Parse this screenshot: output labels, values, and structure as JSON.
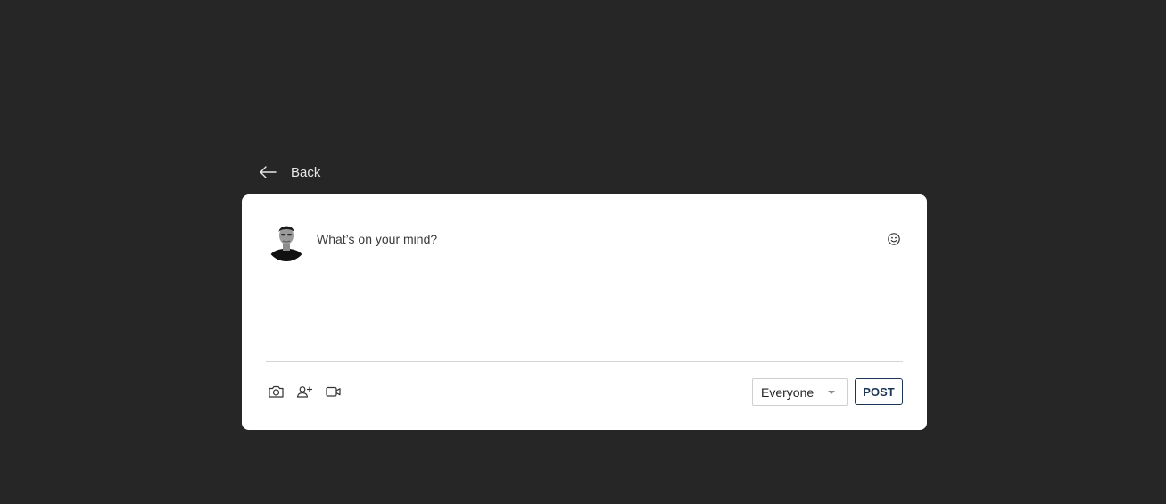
{
  "nav": {
    "back_label": "Back",
    "back_icon": "arrow-left-icon"
  },
  "composer": {
    "placeholder": "What’s on your mind?",
    "value": "",
    "emoji_icon": "smiley-icon"
  },
  "toolbar": {
    "tools": [
      {
        "icon": "camera-icon"
      },
      {
        "icon": "tag-person-icon"
      },
      {
        "icon": "video-icon"
      }
    ],
    "audience": {
      "selected": "Everyone"
    },
    "post_label": "POST"
  },
  "colors": {
    "page_background": "#262626",
    "card_background": "#ffffff",
    "post_accent": "#1c3556"
  }
}
